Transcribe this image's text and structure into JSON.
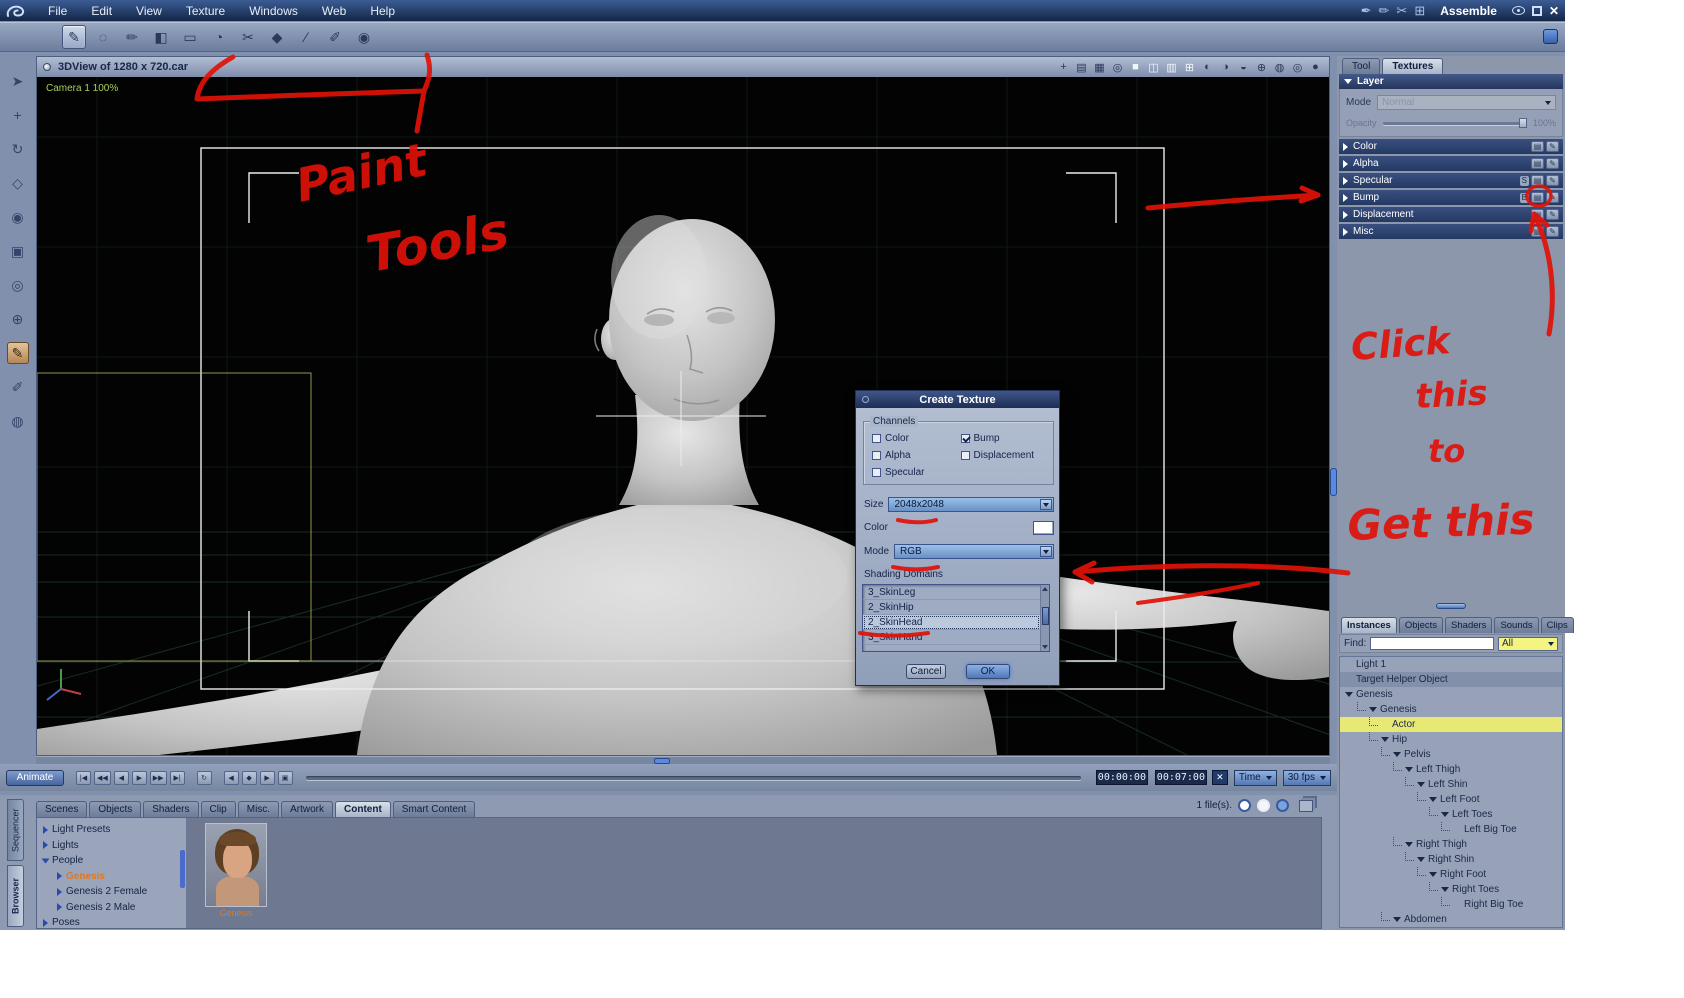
{
  "menubar": {
    "items": [
      "File",
      "Edit",
      "View",
      "Texture",
      "Windows",
      "Web",
      "Help"
    ],
    "right_icons": [
      {
        "name": "pen-nib-icon",
        "glyph": "✒"
      },
      {
        "name": "pencil-icon",
        "glyph": "✏"
      },
      {
        "name": "knife-icon",
        "glyph": "✂"
      },
      {
        "name": "palette-icon",
        "glyph": "⊞"
      }
    ],
    "room_label": "Assemble",
    "close_glyph": "✕"
  },
  "paint_toolbar": {
    "tools": [
      {
        "name": "paintbrush-tool-icon",
        "glyph": "✎",
        "active": true
      },
      {
        "name": "hand-tool-icon",
        "glyph": "◌"
      },
      {
        "name": "pencil-tool-icon",
        "glyph": "✏"
      },
      {
        "name": "fill-tool-icon",
        "glyph": "◧"
      },
      {
        "name": "eraser-tool-icon",
        "glyph": "▭"
      },
      {
        "name": "airbrush-tool-icon",
        "glyph": "◔"
      },
      {
        "name": "scissors-tool-icon",
        "glyph": "✂"
      },
      {
        "name": "shape-tool-icon",
        "glyph": "◆"
      },
      {
        "name": "line-tool-icon",
        "glyph": "∕"
      },
      {
        "name": "eyedropper-tool-icon",
        "glyph": "✐"
      },
      {
        "name": "zoom-tool-icon",
        "glyph": "◉"
      }
    ]
  },
  "left_toolbar": {
    "tools": [
      {
        "name": "pointer-tool-icon",
        "glyph": "➤"
      },
      {
        "name": "move-tool-icon",
        "glyph": "+"
      },
      {
        "name": "rotate-tool-icon",
        "glyph": "↻"
      },
      {
        "name": "scale-tool-icon",
        "glyph": "◇"
      },
      {
        "name": "focus-tool-icon",
        "glyph": "◉"
      },
      {
        "name": "pan-camera-icon",
        "glyph": "▣"
      },
      {
        "name": "bank-camera-icon",
        "glyph": "◎"
      },
      {
        "name": "dolly-camera-icon",
        "glyph": "⊕"
      },
      {
        "name": "paint-3d-tool-icon",
        "glyph": "✎",
        "active": true
      },
      {
        "name": "eyedropper-tool-icon",
        "glyph": "✐"
      },
      {
        "name": "magnify-tool-icon",
        "glyph": "◍"
      }
    ]
  },
  "viewport": {
    "title": "3DView of 1280 x 720.car",
    "camera_label": "Camera 1 100%",
    "header_icons": [
      {
        "name": "track-icon",
        "glyph": "+"
      },
      {
        "name": "properties-icon",
        "glyph": "▤"
      },
      {
        "name": "timeline-icon",
        "glyph": "▦"
      },
      {
        "name": "motion-icon",
        "glyph": "◎"
      },
      {
        "name": "layout-single-icon",
        "glyph": "■",
        "lite": true
      },
      {
        "name": "layout-two-pane-icon",
        "glyph": "◫",
        "lite": true
      },
      {
        "name": "layout-three-pane-icon",
        "glyph": "▥",
        "lite": true
      },
      {
        "name": "layout-four-pane-icon",
        "glyph": "⊞",
        "lite": true
      },
      {
        "name": "camera-view-icon",
        "glyph": "◐"
      },
      {
        "name": "top-view-icon",
        "glyph": "◑"
      },
      {
        "name": "side-view-icon",
        "glyph": "◒"
      },
      {
        "name": "reference-icon",
        "glyph": "⊕"
      },
      {
        "name": "wireframe-sphere-icon",
        "glyph": "◍"
      },
      {
        "name": "flat-sphere-icon",
        "glyph": "◎"
      },
      {
        "name": "shaded-sphere-icon",
        "glyph": "●"
      }
    ]
  },
  "timeline": {
    "animate_label": "Animate",
    "transport": [
      {
        "name": "go-start-button",
        "glyph": "|◀"
      },
      {
        "name": "fast-back-button",
        "glyph": "◀◀"
      },
      {
        "name": "step-back-button",
        "glyph": "◀"
      },
      {
        "name": "play-button",
        "glyph": "▶"
      },
      {
        "name": "fast-forward-button",
        "glyph": "▶▶"
      },
      {
        "name": "go-end-button",
        "glyph": "▶|"
      }
    ],
    "loop_glyph": "↻",
    "key_buttons": [
      {
        "name": "prev-key-button",
        "glyph": "◀"
      },
      {
        "name": "add-key-button",
        "glyph": "◆"
      },
      {
        "name": "next-key-button",
        "glyph": "▶"
      },
      {
        "name": "key-options-button",
        "glyph": "▣"
      }
    ],
    "current_time": "00:00:00",
    "end_time": "00:07:00",
    "delete_glyph": "✕",
    "time_mode": "Time",
    "fps": "30 fps"
  },
  "bottom_panel": {
    "tabs": [
      {
        "label": "Scenes"
      },
      {
        "label": "Objects"
      },
      {
        "label": "Shaders"
      },
      {
        "label": "Clip"
      },
      {
        "label": "Misc."
      },
      {
        "label": "Artwork"
      },
      {
        "label": "Content",
        "active": true
      },
      {
        "label": "Smart Content"
      }
    ],
    "file_count": "1 file(s).",
    "side_tabs": [
      {
        "label": "Sequencer"
      },
      {
        "label": "Browser",
        "active": true
      }
    ],
    "tree": [
      {
        "label": "Light Presets",
        "level": 1
      },
      {
        "label": "Lights",
        "level": 1
      },
      {
        "label": "People",
        "level": 1,
        "exp": true
      },
      {
        "label": "Genesis",
        "level": 2,
        "selected": true
      },
      {
        "label": "Genesis 2 Female",
        "level": 2
      },
      {
        "label": "Genesis 2 Male",
        "level": 2
      },
      {
        "label": "Poses",
        "level": 1
      }
    ],
    "thumbnail_caption": "Genesis"
  },
  "right_panel": {
    "top_tabs": [
      {
        "label": "Tool"
      },
      {
        "label": "Textures",
        "active": true
      }
    ],
    "layer": {
      "header": "Layer",
      "mode_label": "Mode",
      "mode_value": "Normal",
      "opacity_label": "Opacity",
      "opacity_value": "100%",
      "channels": [
        {
          "label": "Color"
        },
        {
          "label": "Alpha"
        },
        {
          "label": "Specular",
          "badge": "S"
        },
        {
          "label": "Bump",
          "badge": "B"
        },
        {
          "label": "Displacement"
        },
        {
          "label": "Misc"
        }
      ]
    },
    "instances": {
      "tabs": [
        {
          "label": "Instances",
          "active": true
        },
        {
          "label": "Objects"
        },
        {
          "label": "Shaders"
        },
        {
          "label": "Sounds"
        },
        {
          "label": "Clips"
        }
      ],
      "find_label": "Find:",
      "find_value": "",
      "filter_value": "All",
      "tree": [
        {
          "label": "Light 1",
          "level": 0,
          "root": true
        },
        {
          "label": "Target Helper Object",
          "level": 0,
          "root": true,
          "band": true
        },
        {
          "label": "Genesis",
          "level": 0,
          "root": true,
          "exp": true
        },
        {
          "label": "Genesis",
          "level": 1,
          "exp": true
        },
        {
          "label": "Actor",
          "level": 2,
          "selected": true
        },
        {
          "label": "Hip",
          "level": 2,
          "exp": true
        },
        {
          "label": "Pelvis",
          "level": 3,
          "exp": true
        },
        {
          "label": "Left Thigh",
          "level": 4,
          "exp": true
        },
        {
          "label": "Left Shin",
          "level": 5,
          "exp": true
        },
        {
          "label": "Left Foot",
          "level": 6,
          "exp": true
        },
        {
          "label": "Left Toes",
          "level": 7,
          "exp": true
        },
        {
          "label": "Left Big Toe",
          "level": 8
        },
        {
          "label": "Right Thigh",
          "level": 4,
          "exp": true
        },
        {
          "label": "Right Shin",
          "level": 5,
          "exp": true
        },
        {
          "label": "Right Foot",
          "level": 6,
          "exp": true
        },
        {
          "label": "Right Toes",
          "level": 7,
          "exp": true
        },
        {
          "label": "Right Big Toe",
          "level": 8
        },
        {
          "label": "Abdomen",
          "level": 3,
          "exp": true
        }
      ]
    }
  },
  "dialog": {
    "title": "Create Texture",
    "channels_label": "Channels",
    "checkboxes": [
      {
        "name": "color-checkbox",
        "label": "Color"
      },
      {
        "name": "bump-checkbox",
        "label": "Bump",
        "checked": true
      },
      {
        "name": "alpha-checkbox",
        "label": "Alpha"
      },
      {
        "name": "displacement-checkbox",
        "label": "Displacement"
      },
      {
        "name": "specular-checkbox",
        "label": "Specular"
      }
    ],
    "size_label": "Size",
    "size_value": "2048x2048",
    "color_label": "Color",
    "mode_label": "Mode",
    "mode_value": "RGB",
    "domains_label": "Shading Domains",
    "domains": [
      {
        "label": "3_SkinLeg"
      },
      {
        "label": "2_SkinHip"
      },
      {
        "label": "2_SkinHead",
        "selected": true
      },
      {
        "label": "3_SkinHand"
      }
    ],
    "cancel_label": "Cancel",
    "ok_label": "OK"
  },
  "annotations": {
    "color": "#e01208",
    "paint_line1": "Paint",
    "paint_line2": "Tools",
    "click_lines": [
      "Click",
      "this",
      "to",
      "Get this"
    ]
  }
}
